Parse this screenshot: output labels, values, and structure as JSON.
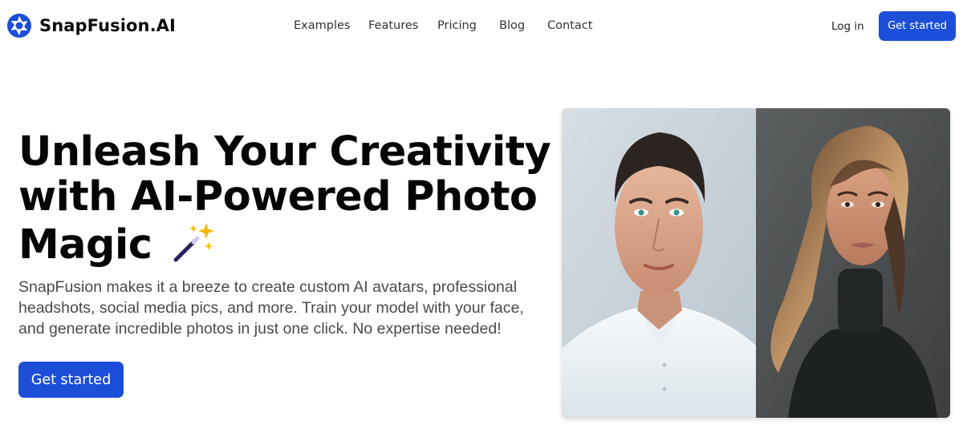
{
  "brand": {
    "name": "SnapFusion.AI",
    "accent": "#1d4ed8"
  },
  "nav": {
    "items": [
      "Examples",
      "Features",
      "Pricing",
      "Blog",
      "Contact"
    ],
    "login": "Log in",
    "cta": "Get started"
  },
  "hero": {
    "headline_lines": [
      "Unleash Your Creativity",
      "with AI-Powered Photo",
      "Magic"
    ],
    "headline_icon": "magic-wand-sparkles-icon",
    "description_lines": [
      "SnapFusion makes it a breeze to create custom AI avatars, professional",
      "headshots, social media pics, and more. Train your model with your face,",
      "and generate incredible photos in just one click. No expertise needed!"
    ],
    "cta": "Get started"
  },
  "photos": [
    {
      "name": "man-headshot-image",
      "background": "#c9d4dd"
    },
    {
      "name": "woman-headshot-image",
      "background": "#4a4d4e"
    }
  ]
}
